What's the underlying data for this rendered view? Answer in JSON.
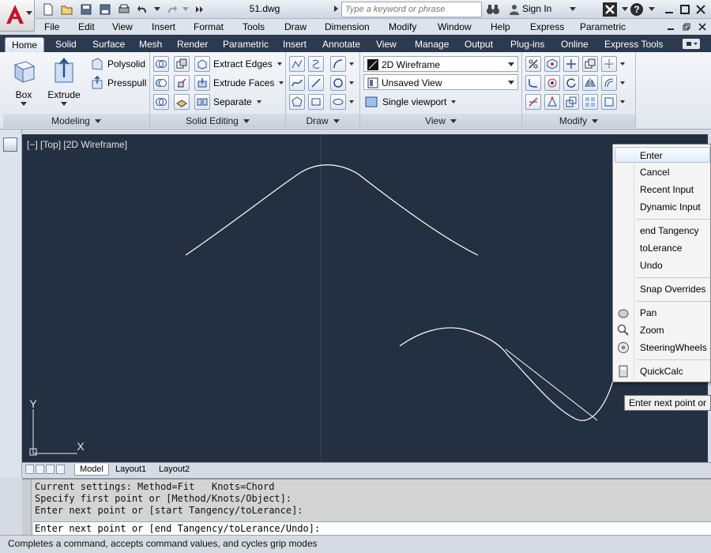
{
  "window": {
    "doc_title": "51.dwg",
    "search_placeholder": "Type a keyword or phrase",
    "sign_in": "Sign In"
  },
  "menubar": [
    "File",
    "Edit",
    "View",
    "Insert",
    "Format",
    "Tools",
    "Draw",
    "Dimension",
    "Modify",
    "Window",
    "Help",
    "Express",
    "Parametric"
  ],
  "ribbon_tabs": [
    "Home",
    "Solid",
    "Surface",
    "Mesh",
    "Render",
    "Parametric",
    "Insert",
    "Annotate",
    "View",
    "Manage",
    "Output",
    "Plug-ins",
    "Online",
    "Express Tools"
  ],
  "active_tab": "Home",
  "panels": {
    "modeling": {
      "title": "Modeling",
      "box": "Box",
      "extrude": "Extrude",
      "polysolid": "Polysolid",
      "presspull": "Presspull"
    },
    "solid_editing": {
      "title": "Solid Editing",
      "extract_edges": "Extract Edges",
      "extrude_faces": "Extrude Faces",
      "separate": "Separate"
    },
    "draw": {
      "title": "Draw"
    },
    "view": {
      "title": "View",
      "visual_style": "2D Wireframe",
      "named_view": "Unsaved View",
      "viewport_config": "Single viewport"
    },
    "modify": {
      "title": "Modify"
    }
  },
  "viewport_label": "[−] [Top] [2D Wireframe]",
  "ucs": {
    "x": "X",
    "y": "Y"
  },
  "layout_tabs": [
    "Model",
    "Layout1",
    "Layout2"
  ],
  "active_layout": "Model",
  "command": {
    "history": [
      "Current settings: Method=Fit   Knots=Chord",
      "Specify first point or [Method/Knots/Object]:",
      "Enter next point or [start Tangency/toLerance]:"
    ],
    "prompt": "Enter next point or [end Tangency/toLerance/Undo]:"
  },
  "status_text": "Completes a command, accepts command values, and cycles grip modes",
  "context_menu": {
    "items": [
      {
        "label": "Enter",
        "highlighted": true
      },
      {
        "label": "Cancel"
      },
      {
        "label": "Recent Input"
      },
      {
        "label": "Dynamic Input"
      },
      {
        "label": "end Tangency"
      },
      {
        "label": "toLerance"
      },
      {
        "label": "Undo"
      },
      {
        "label": "Snap Overrides"
      },
      {
        "label": "Pan",
        "icon": "pan-icon"
      },
      {
        "label": "Zoom",
        "icon": "zoom-icon"
      },
      {
        "label": "SteeringWheels",
        "icon": "steeringwheels-icon"
      },
      {
        "label": "QuickCalc",
        "icon": "quickcalc-icon"
      }
    ]
  },
  "tooltip": "Enter next point or",
  "colors": {
    "canvas_bg": "#233041",
    "ribbon_tab_bar": "#2c3a4f",
    "curve": "#ffffff",
    "autocad_red": "#c8102e"
  }
}
